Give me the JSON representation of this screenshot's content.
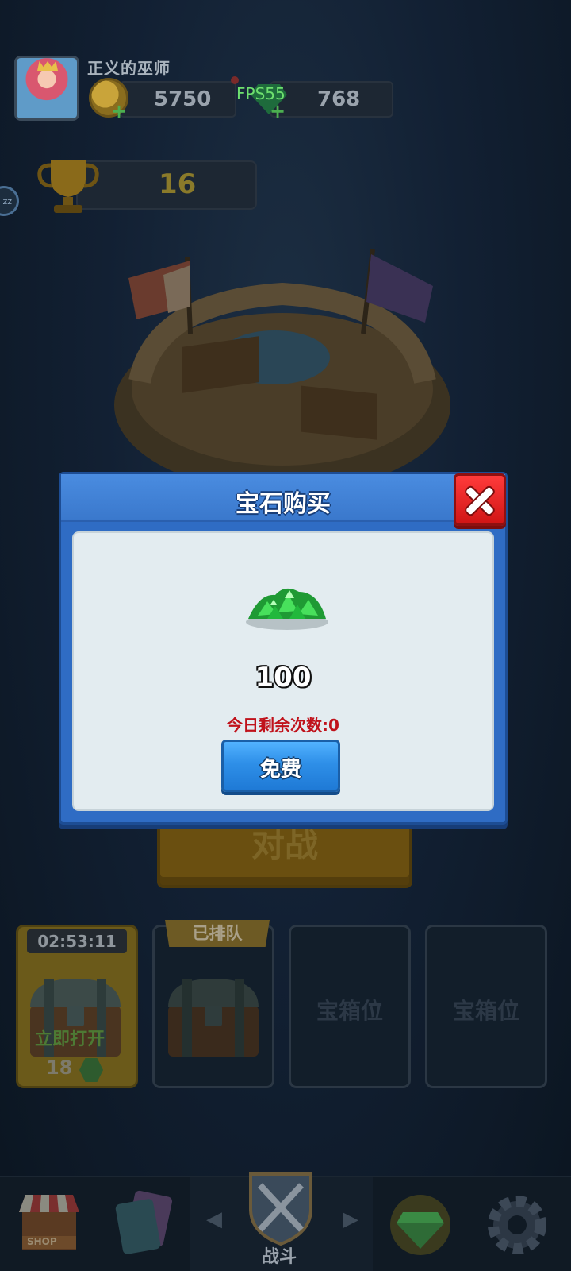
{
  "hud": {
    "player_name": "正义的巫师",
    "gold": "5750",
    "gems": "768",
    "fps": "FPS55",
    "trophies": "16",
    "sleep_badge": "zz",
    "plus": "+"
  },
  "battle": {
    "label": "对战"
  },
  "chests": {
    "slot1": {
      "timer": "02:53:11",
      "open_now": "立即打开",
      "gem_cost": "18"
    },
    "slot2": {
      "status": "已排队"
    },
    "slot3": {
      "label": "宝箱位"
    },
    "slot4": {
      "label": "宝箱位"
    }
  },
  "nav": {
    "shop_label": "SHOP",
    "battle_label": "战斗",
    "left_arrow": "◀",
    "right_arrow": "▶",
    "tabs": [
      "shop-icon",
      "cards-icon",
      "battle-swords-icon",
      "gem-icon",
      "gear-icon"
    ]
  },
  "modal": {
    "title": "宝石购买",
    "amount": "100",
    "remaining": "今日剩余次数:0",
    "button": "免费"
  },
  "colors": {
    "modal_blue": "#2f6cc4",
    "close_red": "#e02020",
    "free_button_blue": "#2e8fe8",
    "remaining_red": "#c0121b",
    "gem_green": "#2fb84a"
  }
}
